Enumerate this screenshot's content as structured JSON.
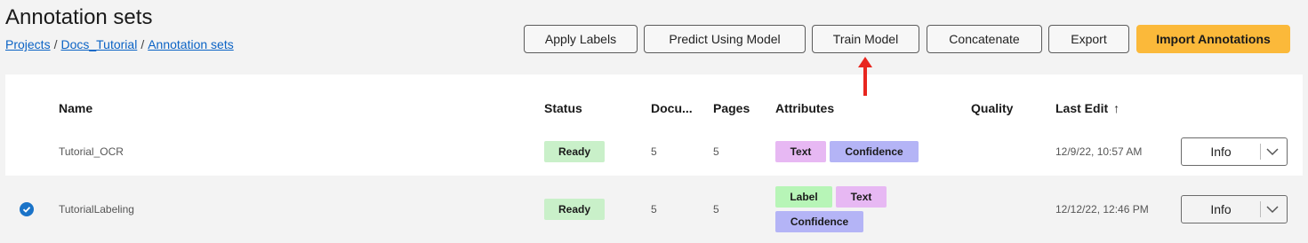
{
  "page": {
    "title": "Annotation sets",
    "breadcrumb": [
      "Projects",
      "Docs_Tutorial",
      "Annotation sets"
    ]
  },
  "toolbar": {
    "apply_labels": "Apply Labels",
    "predict": "Predict Using Model",
    "train": "Train Model",
    "concatenate": "Concatenate",
    "export": "Export",
    "import": "Import Annotations"
  },
  "table": {
    "headers": {
      "name": "Name",
      "status": "Status",
      "documents": "Docu...",
      "pages": "Pages",
      "attributes": "Attributes",
      "quality": "Quality",
      "last_edit": "Last Edit",
      "sort_indicator": "↑"
    },
    "rows": [
      {
        "name": "Tutorial_OCR",
        "status": "Ready",
        "documents": "5",
        "pages": "5",
        "attributes": [
          "Text",
          "Confidence"
        ],
        "last_edit": "12/9/22, 10:57 AM",
        "action": "Info",
        "selected": false
      },
      {
        "name": "TutorialLabeling",
        "status": "Ready",
        "documents": "5",
        "pages": "5",
        "attributes": [
          "Label",
          "Text",
          "Confidence"
        ],
        "last_edit": "12/12/22, 12:46 PM",
        "action": "Info",
        "selected": true
      }
    ]
  },
  "colors": {
    "primary_button": "#fbb93a",
    "link": "#0b63c5",
    "status_ready": "#c9f0c9",
    "tag_text": "#e7b8f3",
    "tag_confidence": "#b4b4f6",
    "tag_label": "#b7f5b7",
    "annotation_arrow": "#e8261f",
    "check": "#1a73c8"
  },
  "icons": {
    "arrow": "red-up-arrow-icon",
    "chevron": "chevron-down-icon",
    "checkbox": "checked-circle-icon"
  }
}
